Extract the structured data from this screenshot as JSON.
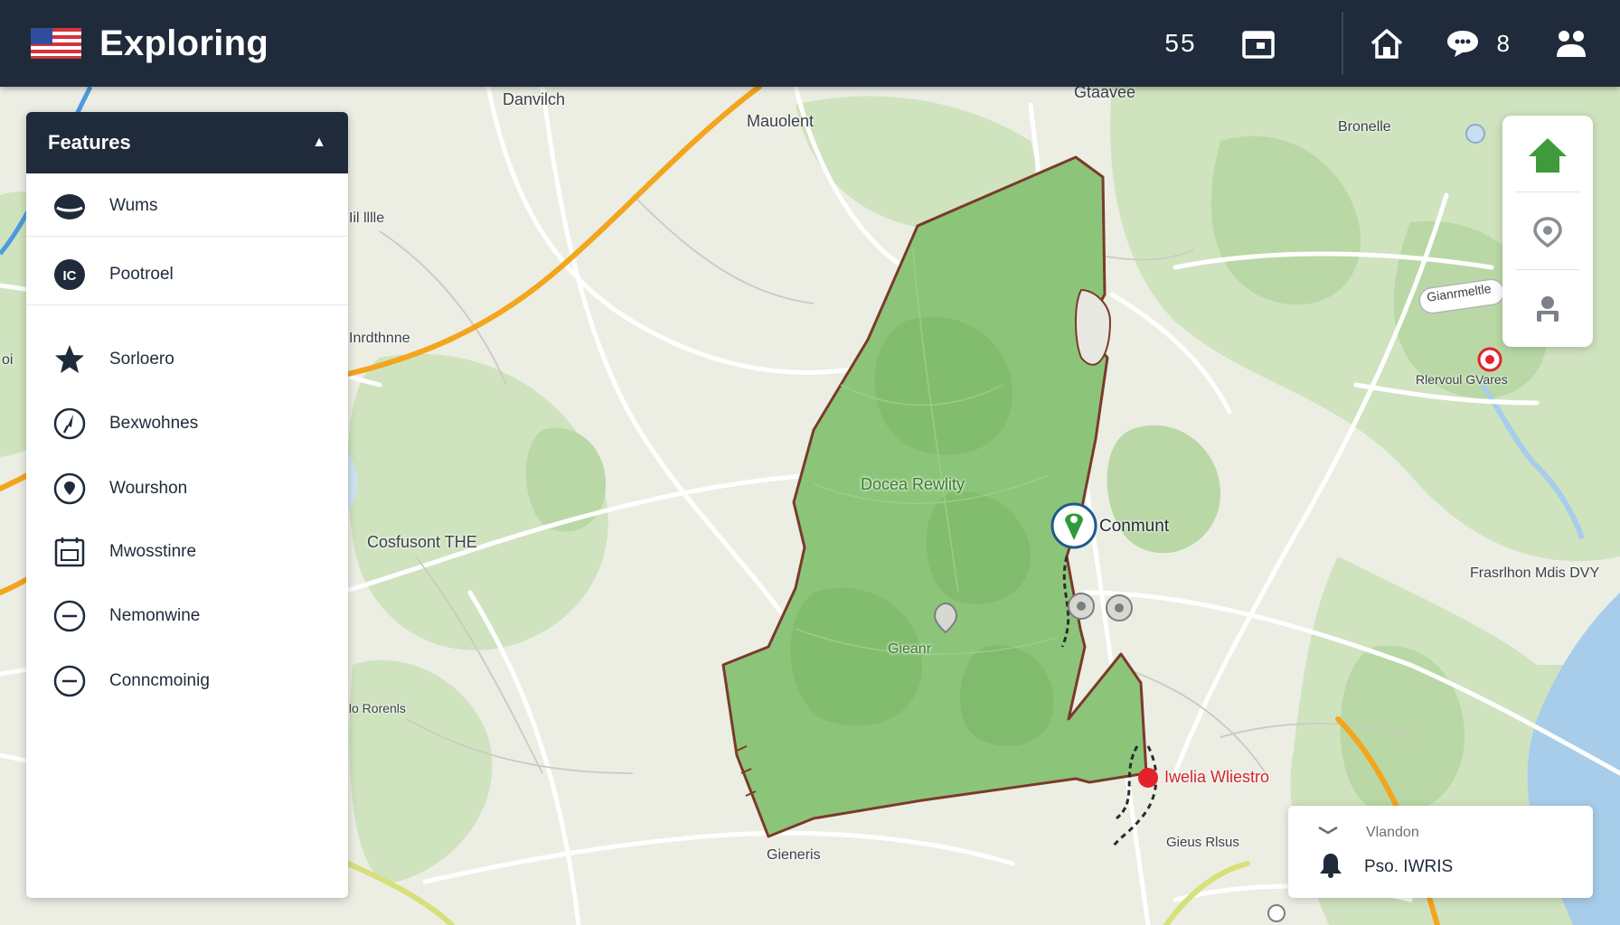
{
  "header": {
    "app_title": "Exploring",
    "count": "55",
    "messages_count": "8",
    "icons": [
      "flag-icon",
      "calendar-icon",
      "home-icon",
      "chat-icon",
      "users-icon"
    ]
  },
  "sidebar": {
    "title": "Features",
    "items": [
      {
        "label": "Wums",
        "icon": "hat-icon"
      },
      {
        "label": "Pootroel",
        "icon": "badge-icon"
      },
      {
        "label": "Sorloero",
        "icon": "star-icon"
      },
      {
        "label": "Bexwohnes",
        "icon": "compass-icon"
      },
      {
        "label": "Wourshon",
        "icon": "location-icon"
      },
      {
        "label": "Mwosstinre",
        "icon": "calendar-icon"
      },
      {
        "label": "Nemonwine",
        "icon": "minus-circle-icon"
      },
      {
        "label": "Conncmoinig",
        "icon": "minus-circle-icon"
      }
    ]
  },
  "map": {
    "labels": {
      "top_left": "Danvilch",
      "top_center": "Mauolent",
      "top_right": "Gtaavee",
      "right_top": "Bronelle",
      "left_mid": "Iil lllle",
      "left_road": "Inrdthnne",
      "left_edge": "oi",
      "center_left": "Cosfusont THE",
      "park_name": "Docea Rewlity",
      "park_sub": "Gieanr",
      "marker_label": "Conmunt",
      "red_label": "Iwelia Wliestro",
      "right_callout": "Gianrmeltle",
      "right_place": "Rlervoul GVares",
      "right_far": "Frasrlhon Mdis DVY",
      "bottom_left": "Ilo Rorenls",
      "bottom_center": "Gieneris",
      "bottom_right": "Gieus Rlsus"
    }
  },
  "map_tools": {
    "icons": [
      "home-icon",
      "locate-icon",
      "person-icon"
    ]
  },
  "info_card": {
    "title": "Vlandon",
    "value": "Pso. IWRIS"
  },
  "colors": {
    "header_bg": "#1f2a3a",
    "park_fill": "#8cc57a",
    "park_border": "#7a3b2a",
    "major_road": "#f3a51d",
    "water": "#9fc8ea",
    "marker_red": "#e3232a",
    "tool_home": "#3f9a3c"
  }
}
